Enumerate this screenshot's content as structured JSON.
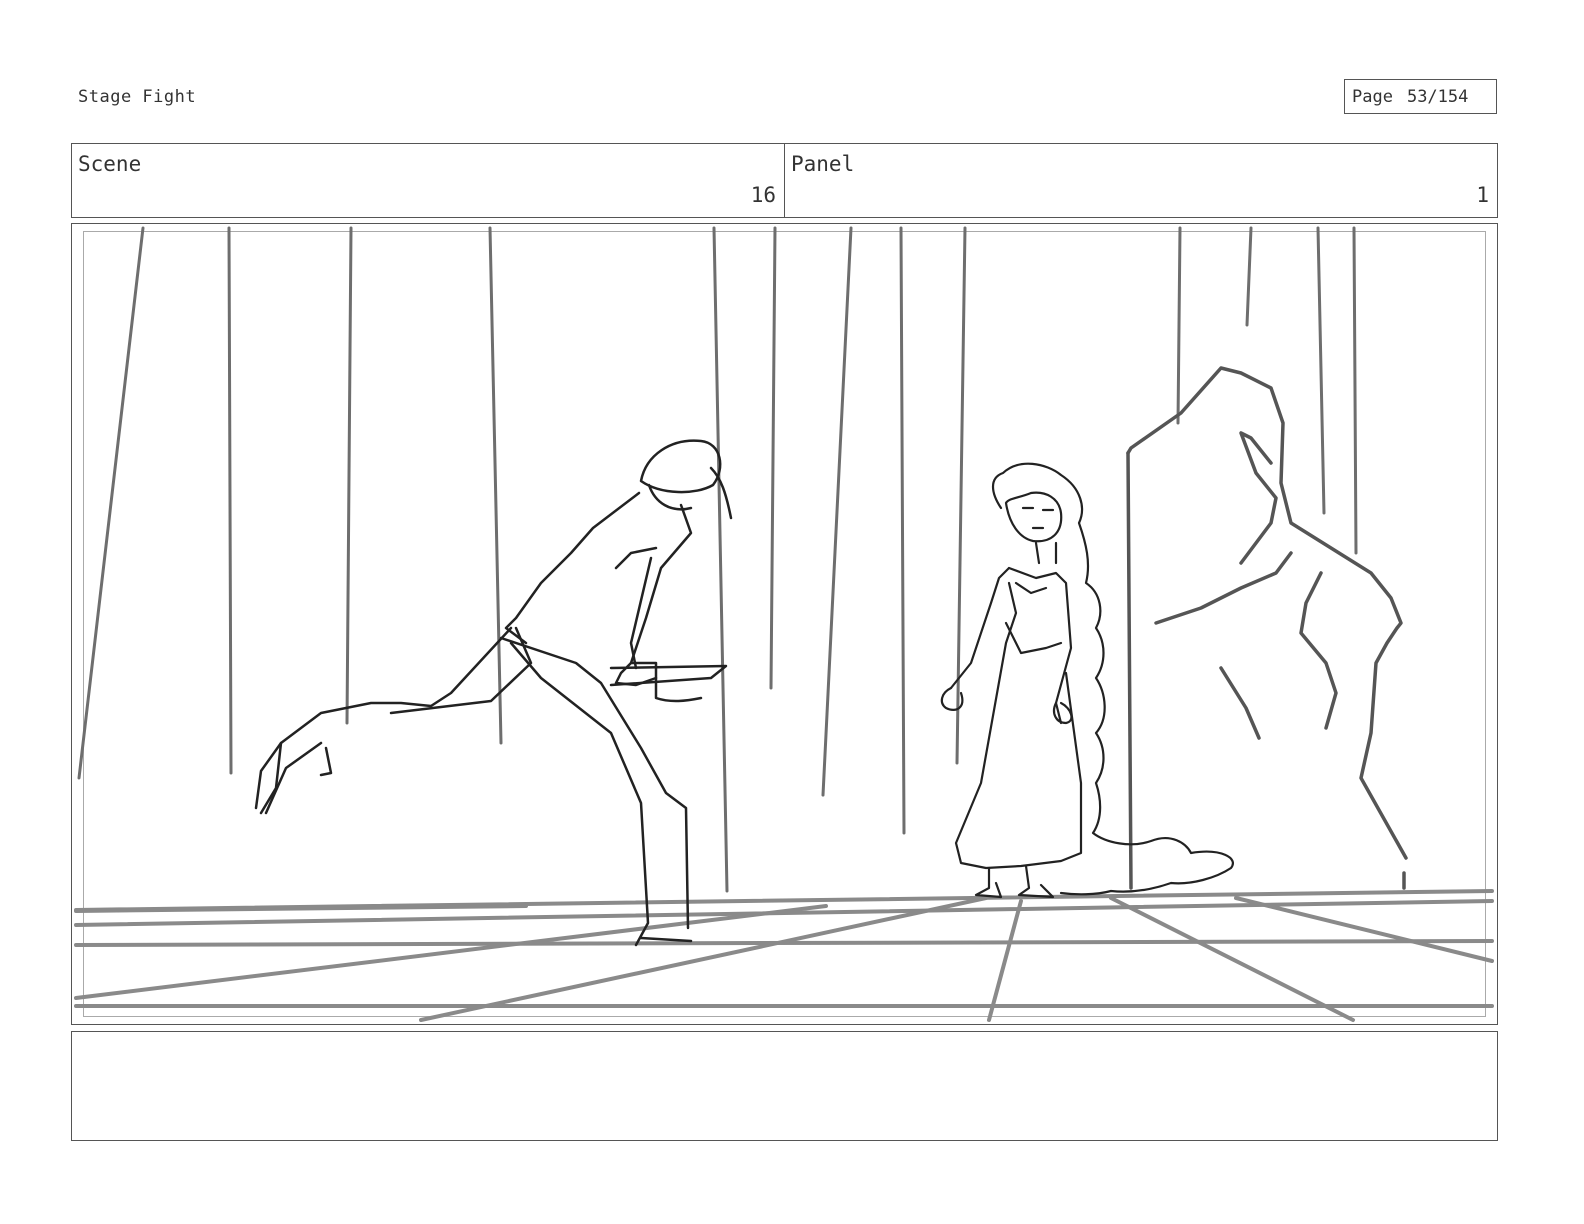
{
  "project_title": "Stage Fight",
  "page": {
    "label": "Page",
    "current_of_total": "53/154"
  },
  "scene": {
    "label": "Scene",
    "value": "16"
  },
  "panel": {
    "label": "Panel",
    "value": "1"
  },
  "notes": {
    "text": ""
  },
  "colors": {
    "ink": "#222222",
    "floor_lines": "#8a8a8a",
    "curtain_lines": "#6e6e6e",
    "rock": "#555555"
  }
}
